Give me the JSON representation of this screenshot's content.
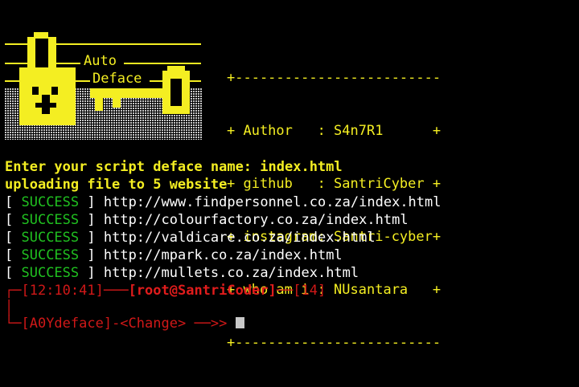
{
  "logo": {
    "text_auto": "Auto",
    "text_deface": "Deface"
  },
  "info_box": {
    "border": "+-------------------------",
    "rows": [
      "+ Author   : S4n7R1      +",
      "+ github   : SantriCyber +",
      "+ instagram: Santri-cyber+",
      "+ who am i : NUsantara   +"
    ],
    "border_bottom": "+-------------------------"
  },
  "prompt_line": "Enter your script deface name: index.html",
  "upload_line": "uploading file to 5 website",
  "results": [
    {
      "status": "SUCCESS",
      "url": "http://www.findpersonnel.co.za/index.html"
    },
    {
      "status": "SUCCESS",
      "url": "http://colourfactory.co.za/index.html"
    },
    {
      "status": "SUCCESS",
      "url": "http://valdicare.co.za/index.html"
    },
    {
      "status": "SUCCESS",
      "url": "http://mpark.co.za/index.html"
    },
    {
      "status": "SUCCESS",
      "url": "http://mullets.co.za/index.html"
    }
  ],
  "shell": {
    "corner_top": "┌─",
    "time": "[12:10:41]",
    "sep1": "───",
    "user": "[root@SantriCoder]",
    "sep2": "──",
    "count": "[14]",
    "pipe": "│",
    "path_prefix": "└─",
    "path": "[A0Ydeface]-<Change>",
    "arrow": "──>>"
  },
  "colors": {
    "background": "#000000",
    "yellow": "#f4ee22",
    "green": "#20c020",
    "red": "#d01818"
  }
}
